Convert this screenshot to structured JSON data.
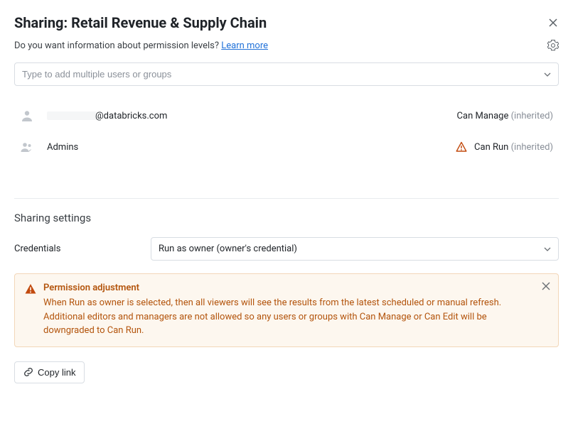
{
  "header": {
    "title": "Sharing: Retail Revenue & Supply Chain"
  },
  "subheader": {
    "prompt": "Do you want information about permission levels?",
    "learn_more": "Learn more"
  },
  "user_input": {
    "placeholder": "Type to add multiple users or groups"
  },
  "members": [
    {
      "name_suffix": "@databricks.com",
      "permission": "Can Manage",
      "inherited": "(inherited)",
      "type": "user",
      "warn": false
    },
    {
      "name": "Admins",
      "permission": "Can Run",
      "inherited": "(inherited)",
      "type": "group",
      "warn": true
    }
  ],
  "settings": {
    "section_title": "Sharing settings",
    "credentials_label": "Credentials",
    "credentials_value": "Run as owner (owner's credential)"
  },
  "alert": {
    "title": "Permission adjustment",
    "body": "When Run as owner is selected, then all viewers will see the results from the latest scheduled or manual refresh. Additional editors and managers are not allowed so any users or groups with Can Manage or Can Edit will be downgraded to Can Run."
  },
  "footer": {
    "copy_link": "Copy link"
  }
}
